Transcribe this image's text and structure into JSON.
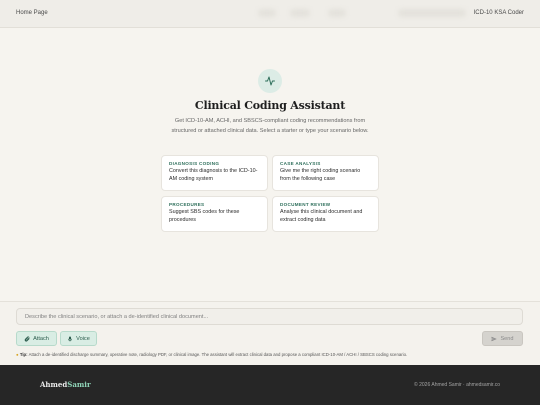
{
  "header": {
    "home_link": "Home Page",
    "brand": "ICD-10 KSA Coder"
  },
  "hero": {
    "icon": "activity-icon",
    "title": "Clinical Coding Assistant",
    "subtitle": "Get ICD-10-AM, ACHI, and SBSCS-compliant coding recommendations from structured or attached clinical data. Select a starter or type your scenario below."
  },
  "starters": [
    {
      "tag": "DIAGNOSIS CODING",
      "text": "Convert this diagnosis to the ICD-10-AM coding system"
    },
    {
      "tag": "CASE ANALYSIS",
      "text": "Give me the right coding scenario from the following case"
    },
    {
      "tag": "PROCEDURES",
      "text": "Suggest SBS codes for these procedures"
    },
    {
      "tag": "DOCUMENT REVIEW",
      "text": "Analyse this clinical document and extract coding data"
    }
  ],
  "composer": {
    "placeholder": "Describe the clinical scenario, or attach a de-identified clinical document...",
    "attach_label": "Attach",
    "voice_label": "Voice",
    "send_label": "Send",
    "tip_label": "Tip:",
    "tip_text": "Attach a de-identified discharge summary, operative note, radiology PDF, or clinical image. The assistant will extract clinical data and propose a compliant ICD-10-AM / ACHI / SBSCS coding scenario."
  },
  "footer": {
    "logo_part1": "Ahmed",
    "logo_part2": "Samir",
    "copyright": "© 2026 Ahmed Samir · ahmedsamir.co"
  },
  "colors": {
    "accent": "#2d6e5a",
    "accent_light": "#d9ede4",
    "background": "#f6f4ef",
    "footer": "#262626"
  }
}
